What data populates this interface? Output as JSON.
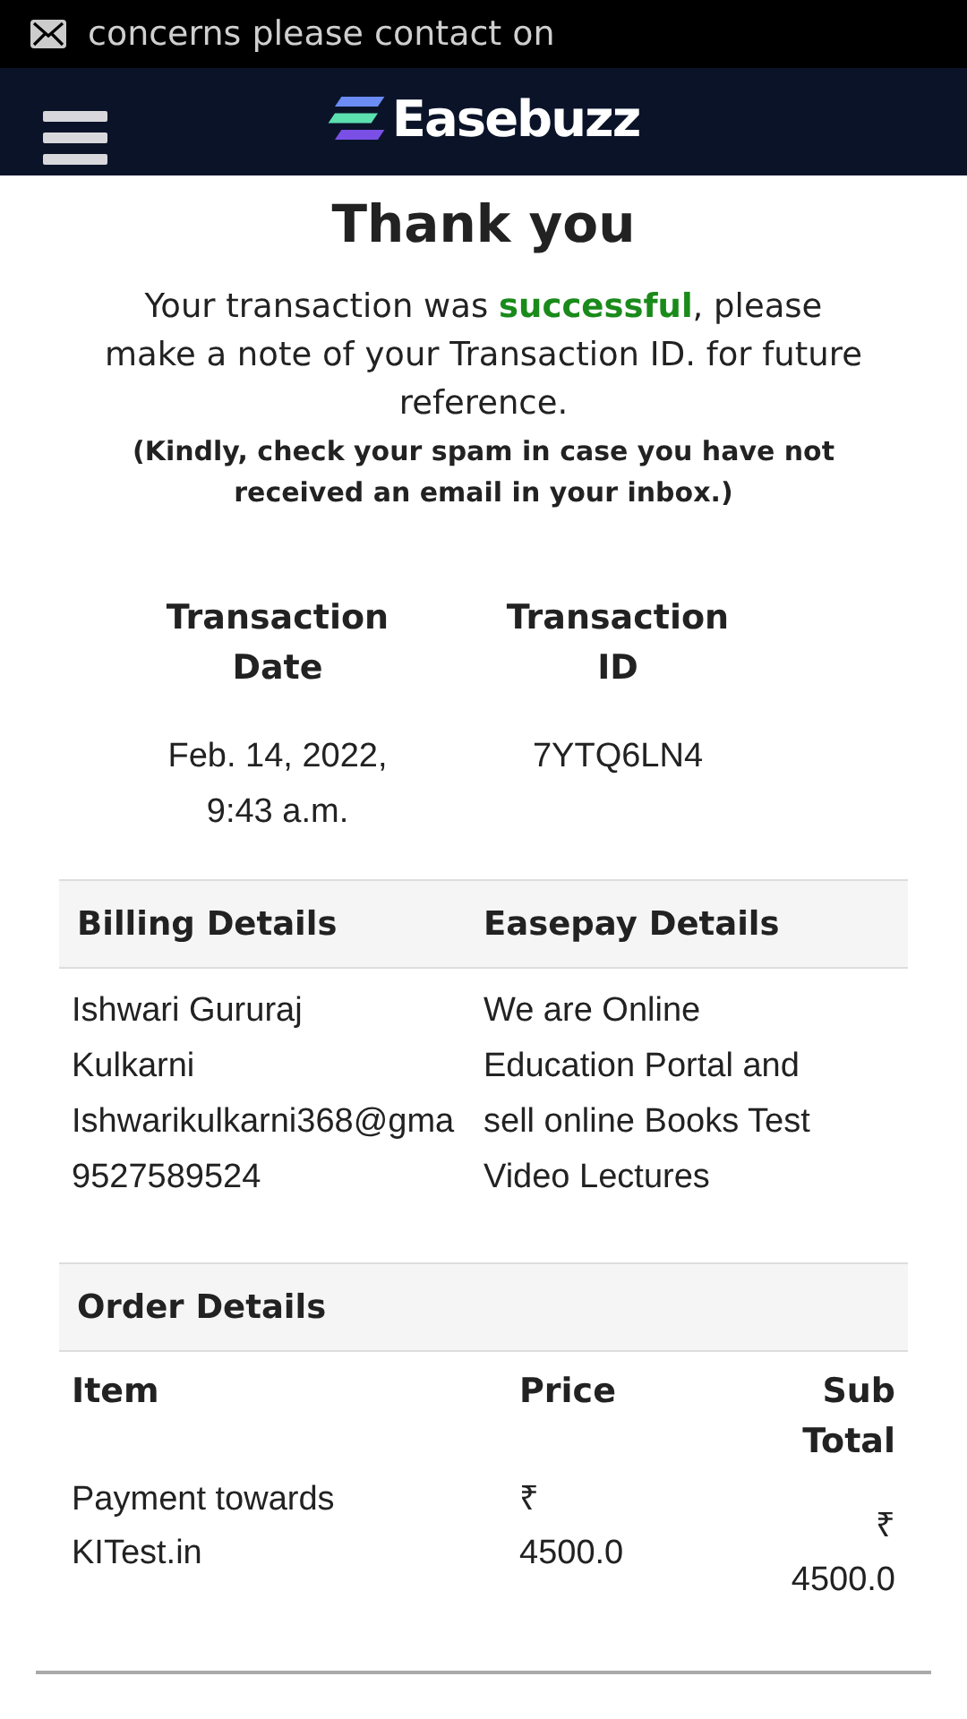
{
  "status_bar": {
    "notification": "concerns please contact on"
  },
  "header": {
    "logo": "Easebuzz"
  },
  "title": "Thank you",
  "message": "Your transaction was **successful**, please make a note of your Transaction ID. for future reference.",
  "note": "(Kindly, check your spam in case you have not received an email in your inbox.)",
  "transaction": [
    {
      "label": "Transaction Date",
      "value": "Feb. 14, 2022, 9:43 a.m."
    },
    {
      "label": "Transaction ID",
      "value": "7YTQ6LN4"
    }
  ],
  "billing": {
    "heading": "Billing Details",
    "lines": [
      "Ishwari Gururaj Kulkarni",
      "Ishwarikulkarni368@gma",
      "9527589524"
    ]
  },
  "easepay": {
    "heading": "Easepay Details",
    "text": "We are Online Education Portal and sell online Books Test Video Lectures"
  },
  "order": {
    "heading": "Order Details",
    "columns": [
      "Item",
      "Price",
      "Sub Total"
    ],
    "rows": [
      {
        "item": "Payment towards KITest.in",
        "price": "₹ 4500.0",
        "subtotal": "₹ 4500.0"
      }
    ]
  }
}
